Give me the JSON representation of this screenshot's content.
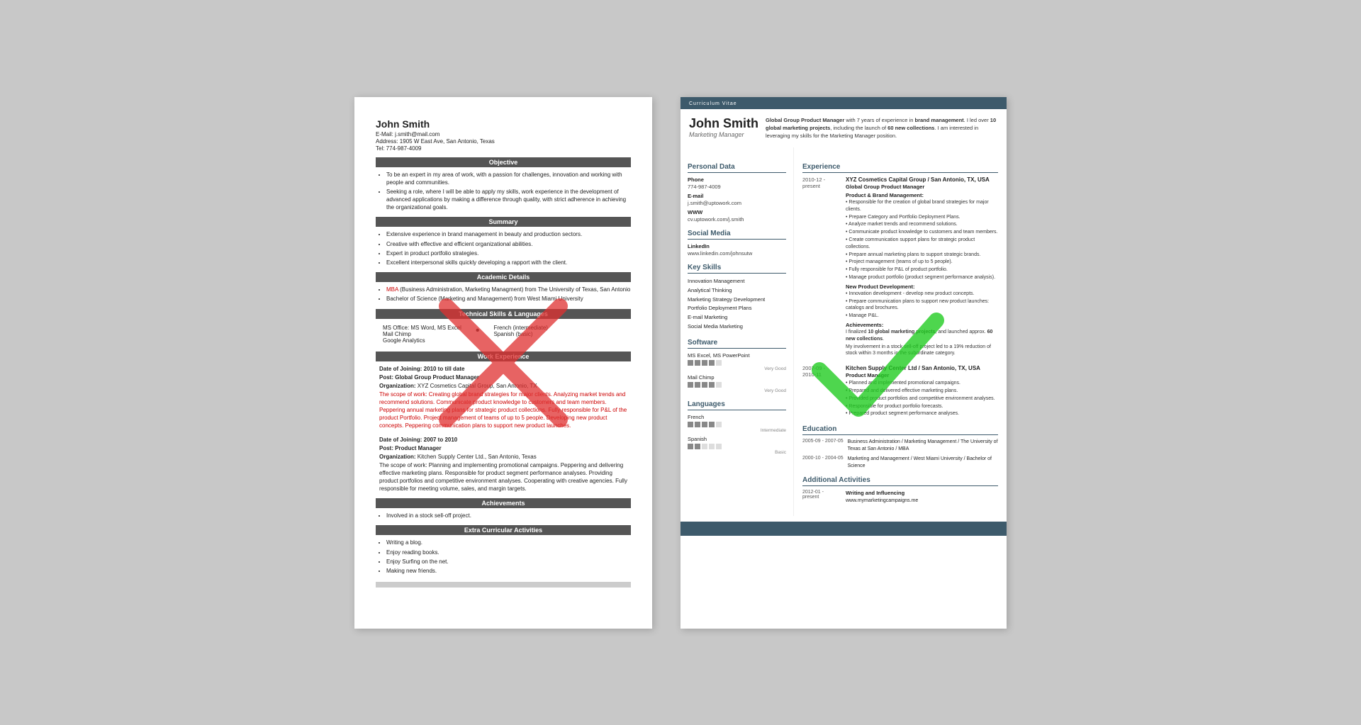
{
  "left_resume": {
    "name": "John Smith",
    "email": "E-Mail: j.smith@mail.com",
    "address": "Address: 1905 W East Ave, San Antonio, Texas",
    "tel": "Tel: 774-987-4009",
    "sections": {
      "objective": "Objective",
      "objective_items": [
        "To be an expert in my area of work, with a passion for challenges, innovation and working with people and communities.",
        "Seeking a role, where I will be able to apply my skills, work experience in the development of advanced applications by making a difference through quality, with strict adherence in achieving the organizational goals."
      ],
      "summary": "Summary",
      "summary_items": [
        "Extensive experience in brand management in beauty and production sectors.",
        "Creative with effective and efficient organizational abilities.",
        "Expert in product portfolio strategies.",
        "Excellent interpersonal skills quickly developing a rapport with the client."
      ],
      "academic": "Academic Details",
      "academic_items": [
        "MBA (Business Administration, Marketing Managment) from The University of Texas, San Antonio",
        "Bachelor of Science (Marketing and Management) from West Miami University"
      ],
      "technical": "Technical Skills & Languages",
      "skills_left": [
        "MS Office: MS Word, MS Excel",
        "Mail Chimp",
        "Google Analytics"
      ],
      "skills_right_label": [
        "French (intermediate)",
        "Spanish (basic)"
      ],
      "work_experience": "Work Experience",
      "work1_date": "Date of Joining: 2010 to till date",
      "work1_post": "Post: Global Group Product Manager",
      "work1_org": "Organization: XYZ Cosmetics Capital Group, San Antonio, TX",
      "work1_scope": "The scope of work: Creating global brand strategies for major clients. Analyzing market trends and recommend solutions. Communicate product knowledge to customers and team members. Peppering annual marketing plans for strategic product collections. Fully responsible for P&L of the product Portfolio. Project management of teams of up to 5 people. Developing new product concepts. Peppering communication plans to support new product launches.",
      "work2_date": "Date of Joining: 2007 to 2010",
      "work2_post": "Post: Product Manager",
      "work2_org": "Organization: Kitchen Supply Center Ltd., San Antonio, Texas",
      "work2_scope": "The scope of work: Planning and implementing promotional campaigns. Peppering and delivering effective marketing plans. Responsible for product segment performance analyses. Providing product portfolios and competitive environment analyses. Cooperating with creative agencies. Fully responsible for meeting volume, sales, and margin targets.",
      "achievements": "Achievements",
      "achievement_items": [
        "Involved in a stock sell-off project."
      ],
      "extra": "Extra Curricular Activities",
      "extra_items": [
        "Writing a blog.",
        "Enjoy reading books.",
        "Enjoy Surfing on the net.",
        "Making new friends."
      ]
    }
  },
  "right_resume": {
    "cv_label": "Curriculum Vitae",
    "name": "John Smith",
    "title": "Marketing Manager",
    "summary_text": "Global Group Product Manager with 7 years of experience in brand management. I led over 10 global marketing projects, including the launch of 60 new collections. I am interested in leveraging my skills for the Marketing Manager position.",
    "personal_data": {
      "section": "Personal Data",
      "phone_label": "Phone",
      "phone": "774-987-4009",
      "email_label": "E-mail",
      "email": "j.smith@uptowork.com",
      "www_label": "WWW",
      "www": "cv.uptowork.com/j.smith"
    },
    "social_media": {
      "section": "Social Media",
      "linkedin_label": "LinkedIn",
      "linkedin": "www.linkedin.com/johnsutw"
    },
    "key_skills": {
      "section": "Key Skills",
      "items": [
        "Innovation Management",
        "Analytical Thinking",
        "Marketing Strategy Development",
        "Portfolio Deployment Plans",
        "E-mail Marketing",
        "Social Media Marketing"
      ]
    },
    "software": {
      "section": "Software",
      "items": [
        {
          "name": "MS Excel, MS PowerPoint",
          "level": "Very Good",
          "dots": 4,
          "total": 5
        },
        {
          "name": "Mail Chimp",
          "level": "Very Good",
          "dots": 4,
          "total": 5
        }
      ]
    },
    "languages": {
      "section": "Languages",
      "items": [
        {
          "name": "French",
          "level": "Intermediate",
          "dots": 4,
          "total": 5
        },
        {
          "name": "Spanish",
          "level": "Basic",
          "dots": 2,
          "total": 5
        }
      ]
    },
    "experience": {
      "section": "Experience",
      "jobs": [
        {
          "date_start": "2010-12 -",
          "date_end": "present",
          "company": "XYZ Cosmetics Capital Group / San Antonio, TX, USA",
          "role": "Global Group Product Manager",
          "product_brand_label": "Product & Brand Management:",
          "bullets": [
            "Responsible for the creation of global brand strategies for major clients.",
            "Prepare Category and Portfolio Deployment Plans.",
            "Analyze market trends and recommend solutions.",
            "Communicate product knowledge to customers and team members.",
            "Create communication support plans for strategic product collections.",
            "Prepare annual marketing plans to support strategic brands.",
            "Project management (teams of up to 5 people).",
            "Fully responsible for P&L of product portfolio.",
            "Manage product portfolio (product segment performance analysis)."
          ],
          "new_product_label": "New Product Development:",
          "new_product_bullets": [
            "Innovation development - develop new product concepts.",
            "Prepare communication plans to support new product launches: catalogs and brochures.",
            "Manage P&L."
          ],
          "achievements_label": "Achievements:",
          "achievements_text": "I finalized 10 global marketing projects, and launched approx. 60 new collections.",
          "achievements_text2": "My involvement in a stock sell-off project led to a 19% reduction of stock within 3 months in the subordinate category."
        },
        {
          "date_start": "2007-09 -",
          "date_end": "2010-11",
          "company": "Kitchen Supply Center Ltd / San Antonio, TX, USA",
          "role": "Product Manager",
          "bullets": [
            "Planned and implemented promotional campaigns.",
            "Prepared and delivered effective marketing plans.",
            "Provided product portfolios and competitive environment analyses.",
            "Responsible for product portfolio forecasts.",
            "Prepared product segment performance analyses."
          ]
        }
      ]
    },
    "education": {
      "section": "Education",
      "items": [
        {
          "date": "2005-09 - 2007-05",
          "text": "Business Administration / Marketing Management / The University of Texas at San Antonio / MBA"
        },
        {
          "date": "2000-10 - 2004-05",
          "text": "Marketing and Management / West Miami University / Bachelor of Science"
        }
      ]
    },
    "additional": {
      "section": "Additional Activities",
      "items": [
        {
          "date": "2012-01 - present",
          "title": "Writing and Influencing",
          "url": "www.mymarketingcampaigns.me"
        }
      ]
    }
  }
}
